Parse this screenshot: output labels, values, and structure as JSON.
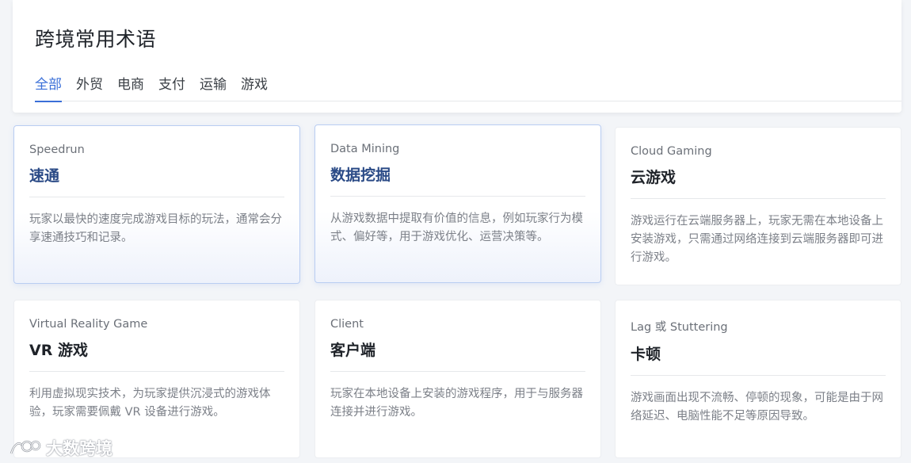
{
  "page": {
    "title": "跨境常用术语"
  },
  "tabs": [
    {
      "label": "全部",
      "active": true
    },
    {
      "label": "外贸",
      "active": false
    },
    {
      "label": "电商",
      "active": false
    },
    {
      "label": "支付",
      "active": false
    },
    {
      "label": "运输",
      "active": false
    },
    {
      "label": "游戏",
      "active": false
    }
  ],
  "cards": [
    {
      "en": "Speedrun",
      "zh": "速通",
      "desc": "玩家以最快的速度完成游戏目标的玩法，通常会分享速通技巧和记录。"
    },
    {
      "en": "Data Mining",
      "zh": "数据挖掘",
      "desc": "从游戏数据中提取有价值的信息，例如玩家行为模式、偏好等，用于游戏优化、运营决策等。"
    },
    {
      "en": "Cloud Gaming",
      "zh": "云游戏",
      "desc": "游戏运行在云端服务器上，玩家无需在本地设备上安装游戏，只需通过网络连接到云端服务器即可进行游戏。"
    },
    {
      "en": "Virtual Reality Game",
      "zh": "VR 游戏",
      "desc": "利用虚拟现实技术，为玩家提供沉浸式的游戏体验，玩家需要佩戴 VR 设备进行游戏。"
    },
    {
      "en": "Client",
      "zh": "客户端",
      "desc": "玩家在本地设备上安装的游戏程序，用于与服务器连接并进行游戏。"
    },
    {
      "en": "Lag 或 Stuttering",
      "zh": "卡顿",
      "desc": "游戏画面出现不流畅、停顿的现象，可能是由于网络延迟、电脑性能不足等原因导致。"
    }
  ],
  "watermark": {
    "text": "大数跨境"
  },
  "colors": {
    "accent": "#3a6fd8",
    "highlight_title": "#2a4a86"
  }
}
